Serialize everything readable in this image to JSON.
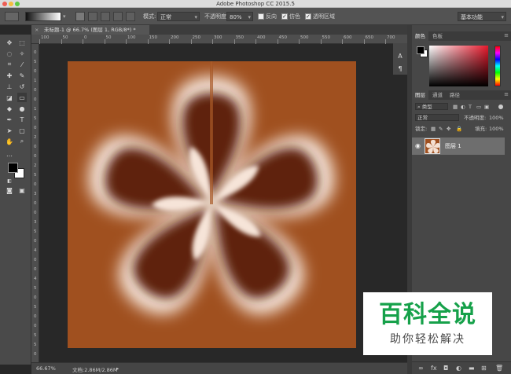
{
  "app": {
    "title": "Adobe Photoshop CC 2015.5"
  },
  "options_bar": {
    "mode_label": "模式:",
    "mode_value": "正常",
    "opacity_label": "不透明度:",
    "opacity_value": "80%",
    "reverse_label": "反向",
    "dither_label": "仿色",
    "transparency_label": "透明区域",
    "workspace_value": "基本功能"
  },
  "document": {
    "tab_title": "未标题-1 @ 66.7% (图层 1, RGB/8*) *",
    "zoom": "66.67%",
    "doc_size": "文档:2.86M/2.86M"
  },
  "rulers": {
    "h_labels": [
      "100",
      "50",
      "0",
      "50",
      "100",
      "150",
      "200",
      "250",
      "300",
      "350",
      "400",
      "450",
      "500",
      "550",
      "600",
      "650",
      "700"
    ],
    "v_labels": [
      "0",
      "5",
      "0",
      "1",
      "0",
      "0",
      "1",
      "5",
      "0",
      "2",
      "0",
      "0",
      "2",
      "5",
      "0",
      "3",
      "0",
      "0",
      "3",
      "5",
      "0",
      "4",
      "0",
      "0",
      "4",
      "5",
      "0",
      "5",
      "0",
      "0",
      "5",
      "5",
      "0"
    ]
  },
  "color_panel": {
    "tabs": [
      "颜色",
      "色板"
    ]
  },
  "layers_panel": {
    "tabs": [
      "图层",
      "通道",
      "路径"
    ],
    "kind_filter": "类型",
    "blend_mode": "正常",
    "opacity_label": "不透明度:",
    "opacity_value": "100%",
    "lock_label": "锁定:",
    "fill_label": "填充:",
    "fill_value": "100%",
    "layers": [
      {
        "name": "图层 1"
      }
    ],
    "bottom_icons": [
      "∞",
      "fx",
      "◘",
      "◐",
      "▬",
      "⊞",
      "🗑"
    ]
  },
  "watermark": {
    "main": "百科全说",
    "sub": "助你轻松解决"
  },
  "colors": {
    "canvas_bg": "#a0501f",
    "watermark_green": "#16a14a"
  }
}
